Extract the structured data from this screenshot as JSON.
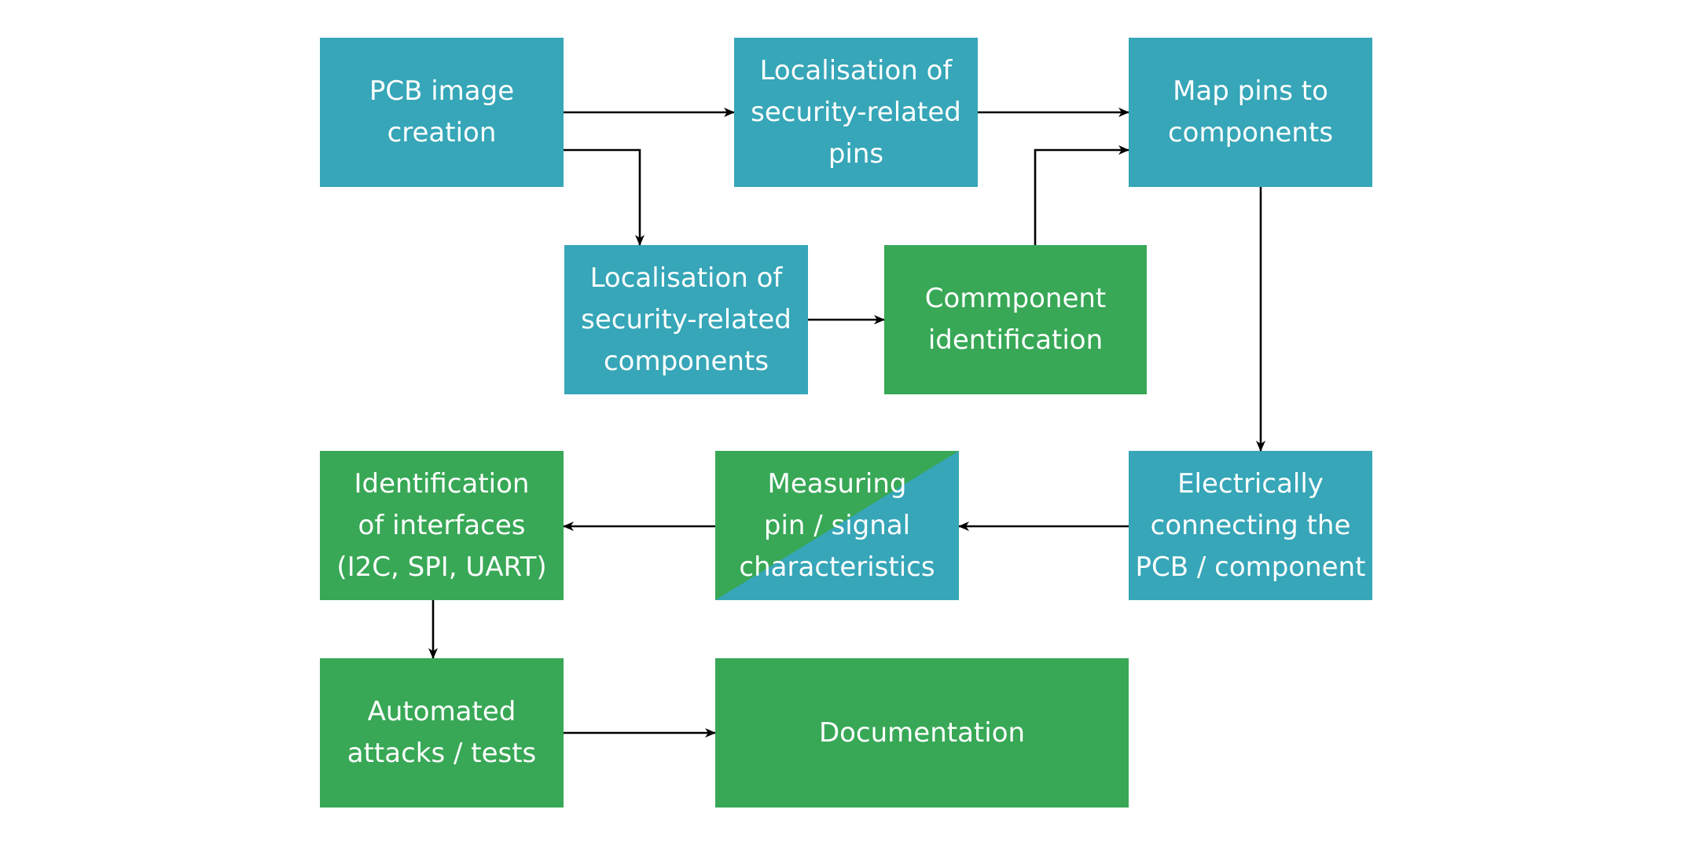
{
  "diagram": {
    "colors": {
      "teal": "#36a6b8",
      "green": "#38a856",
      "arrow": "#000000"
    },
    "nodes": [
      {
        "id": "pcb-image-creation",
        "lines": [
          "PCB image",
          "creation"
        ],
        "color": "teal"
      },
      {
        "id": "localisation-pins",
        "lines": [
          "Localisation of",
          "security-related",
          "pins"
        ],
        "color": "teal"
      },
      {
        "id": "map-pins",
        "lines": [
          "Map pins to",
          "components"
        ],
        "color": "teal"
      },
      {
        "id": "localisation-components",
        "lines": [
          "Localisation of",
          "security-related",
          "components"
        ],
        "color": "teal"
      },
      {
        "id": "component-identification",
        "lines": [
          "Commponent",
          "identification"
        ],
        "color": "green"
      },
      {
        "id": "identification-interfaces",
        "lines": [
          "Identification",
          "of interfaces",
          "(I2C, SPI, UART)"
        ],
        "color": "green"
      },
      {
        "id": "measuring",
        "lines": [
          "Measuring",
          "pin / signal",
          "characteristics"
        ],
        "color": "green/teal split"
      },
      {
        "id": "electrically-connecting",
        "lines": [
          "Electrically",
          "connecting the",
          "PCB / component"
        ],
        "color": "teal"
      },
      {
        "id": "automated-attacks",
        "lines": [
          "Automated",
          "attacks / tests"
        ],
        "color": "green"
      },
      {
        "id": "documentation",
        "lines": [
          "Documentation"
        ],
        "color": "green"
      }
    ],
    "edges": [
      {
        "from": "pcb-image-creation",
        "to": "localisation-pins"
      },
      {
        "from": "pcb-image-creation",
        "to": "localisation-components"
      },
      {
        "from": "localisation-pins",
        "to": "map-pins"
      },
      {
        "from": "localisation-components",
        "to": "component-identification"
      },
      {
        "from": "component-identification",
        "to": "map-pins"
      },
      {
        "from": "map-pins",
        "to": "electrically-connecting"
      },
      {
        "from": "electrically-connecting",
        "to": "measuring"
      },
      {
        "from": "measuring",
        "to": "identification-interfaces"
      },
      {
        "from": "identification-interfaces",
        "to": "automated-attacks"
      },
      {
        "from": "automated-attacks",
        "to": "documentation"
      }
    ]
  }
}
